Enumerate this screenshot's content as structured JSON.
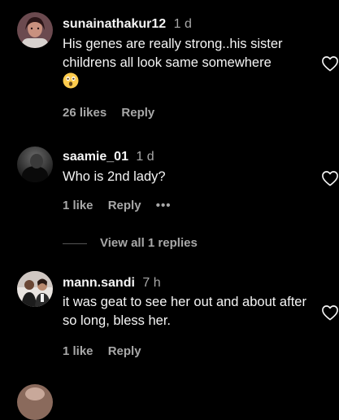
{
  "comments": [
    {
      "username": "sunainathakur12",
      "time": "1 d",
      "text": "His genes are really strong..his sister childrens all look same somewhere",
      "emoji": "astonished-face",
      "likes": "26 likes",
      "reply": "Reply"
    },
    {
      "username": "saamie_01",
      "time": "1 d",
      "text": "Who is 2nd lady?",
      "likes": "1 like",
      "reply": "Reply",
      "more": "•••"
    },
    {
      "username": "mann.sandi",
      "time": "7 h",
      "text": "it was geat to see her out and about after so long, bless her.",
      "likes": "1 like",
      "reply": "Reply"
    }
  ],
  "view_replies": "View all 1 replies",
  "colors": {
    "background": "#000000",
    "primary_text": "#f5f5f5",
    "secondary_text": "#a8a8a8"
  },
  "icons": {
    "like": "heart-outline-icon",
    "more": "more-options-icon"
  }
}
